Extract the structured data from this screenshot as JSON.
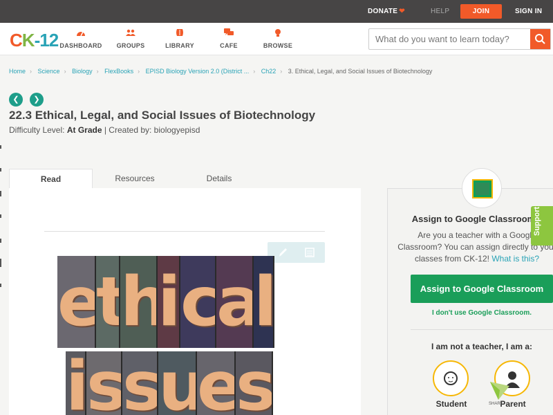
{
  "topbar": {
    "donate": "DONATE",
    "help": "HELP",
    "join": "JOIN",
    "signin": "SIGN IN"
  },
  "nav": {
    "logo_c": "C",
    "logo_k": "K",
    "logo_dash": "-",
    "logo_num": "12",
    "items": [
      {
        "label": "DASHBOARD",
        "icon": "dashboard-icon"
      },
      {
        "label": "GROUPS",
        "icon": "groups-icon"
      },
      {
        "label": "LIBRARY",
        "icon": "library-icon"
      },
      {
        "label": "CAFE",
        "icon": "cafe-icon"
      },
      {
        "label": "BROWSE",
        "icon": "browse-icon"
      }
    ],
    "search_placeholder": "What do you want to learn today?"
  },
  "breadcrumb": [
    "Home",
    "Science",
    "Biology",
    "FlexBooks",
    "EPISD Biology Version 2.0 (District ...",
    "Ch22",
    "3. Ethical, Legal, and Social Issues of Biotechnology"
  ],
  "page": {
    "title": "22.3 Ethical, Legal, and Social Issues of Biotechnology",
    "difficulty_prefix": "Difficulty Level:",
    "difficulty": "At Grade",
    "created_by": "| Created by: biologyepisd"
  },
  "tabs": [
    "Read",
    "Resources",
    "Details"
  ],
  "hero": {
    "row1": [
      "e",
      "t",
      "h",
      "i",
      "c",
      "a",
      "l"
    ],
    "row2": [
      "i",
      "s",
      "s",
      "u",
      "e",
      "s"
    ]
  },
  "sidebar": {
    "heading": "Assign to Google Classroom",
    "text": "Are you a teacher with a Google Classroom? You can assign directly to your classes from CK-12!",
    "link": "What is this?",
    "assign_button": "Assign to Google Classroom",
    "dont_use": "I don't use Google Classroom.",
    "not_teacher": "I am not a teacher, I am a:",
    "student": "Student",
    "parent": "Parent"
  },
  "support": "Support",
  "share": "SHARE",
  "colors": {
    "brand_orange": "#f15a29",
    "brand_green": "#7fb544",
    "brand_teal": "#29a3b6",
    "classroom_green": "#1a9e59"
  }
}
